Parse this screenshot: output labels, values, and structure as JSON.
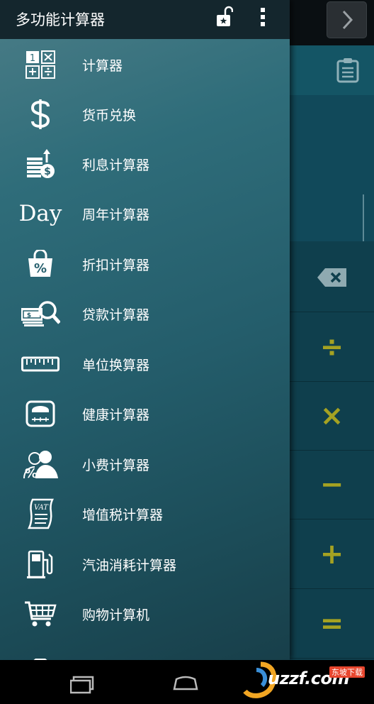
{
  "app": {
    "title": "多功能计算器"
  },
  "menu": [
    {
      "id": "calculator",
      "label": "计算器",
      "icon": "calculator-icon"
    },
    {
      "id": "currency",
      "label": "货币兑换",
      "icon": "dollar-icon"
    },
    {
      "id": "interest",
      "label": "利息计算器",
      "icon": "interest-coins-icon"
    },
    {
      "id": "anniversary",
      "label": "周年计算器",
      "icon": "day-icon",
      "icon_text": "Day"
    },
    {
      "id": "discount",
      "label": "折扣计算器",
      "icon": "discount-bag-icon"
    },
    {
      "id": "loan",
      "label": "贷款计算器",
      "icon": "loan-search-icon"
    },
    {
      "id": "unit",
      "label": "单位换算器",
      "icon": "ruler-icon"
    },
    {
      "id": "health",
      "label": "健康计算器",
      "icon": "scale-icon"
    },
    {
      "id": "tip",
      "label": "小费计算器",
      "icon": "tip-person-icon"
    },
    {
      "id": "vat",
      "label": "增值税计算器",
      "icon": "vat-receipt-icon",
      "icon_text": "VAT"
    },
    {
      "id": "fuel",
      "label": "汽油消耗计算器",
      "icon": "fuel-pump-icon"
    },
    {
      "id": "shopping",
      "label": "购物计算机",
      "icon": "shopping-cart-icon"
    }
  ],
  "background_keys": [
    {
      "name": "backspace",
      "symbol": ""
    },
    {
      "name": "divide",
      "symbol": "÷"
    },
    {
      "name": "multiply",
      "symbol": "×"
    },
    {
      "name": "minus",
      "symbol": "−"
    },
    {
      "name": "plus",
      "symbol": "+"
    },
    {
      "name": "equals",
      "symbol": "="
    }
  ],
  "watermark": {
    "text": "uzzf.com",
    "badge": "东坡下载"
  },
  "colors": {
    "drawer": "#2f6d7a",
    "header": "#14262d",
    "operator": "#a5a222"
  }
}
